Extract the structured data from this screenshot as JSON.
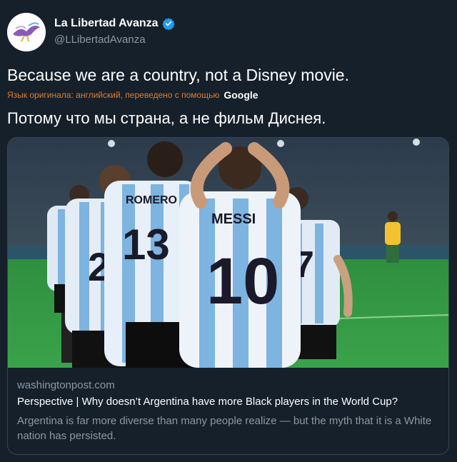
{
  "author": {
    "display_name": "La Libertad Avanza",
    "handle": "@LLibertadAvanza",
    "verified_icon": "verified-badge-icon",
    "verified_color": "#1d9bf0"
  },
  "tweet": {
    "text": "Because we are a country, not a Disney movie.",
    "translation_notice": "Язык оригинала: английский, переведено с помощью",
    "translation_provider": "Google",
    "translated_text": "Потому что мы страна, а не фильм Диснея."
  },
  "card": {
    "image": {
      "jersey_names": [
        "MESSI",
        "ROMERO"
      ],
      "jersey_numbers": [
        "10",
        "13",
        "20",
        "7"
      ]
    },
    "domain": "washingtonpost.com",
    "title": "Perspective | Why doesn’t Argentina have more Black players in the World Cup?",
    "description": "Argentina is far more diverse than many people realize — but the myth that it is a White nation has persisted."
  },
  "colors": {
    "background": "#15202b",
    "border": "#38444d",
    "secondary_text": "#8b98a5",
    "translation_text": "#e27c2a"
  }
}
